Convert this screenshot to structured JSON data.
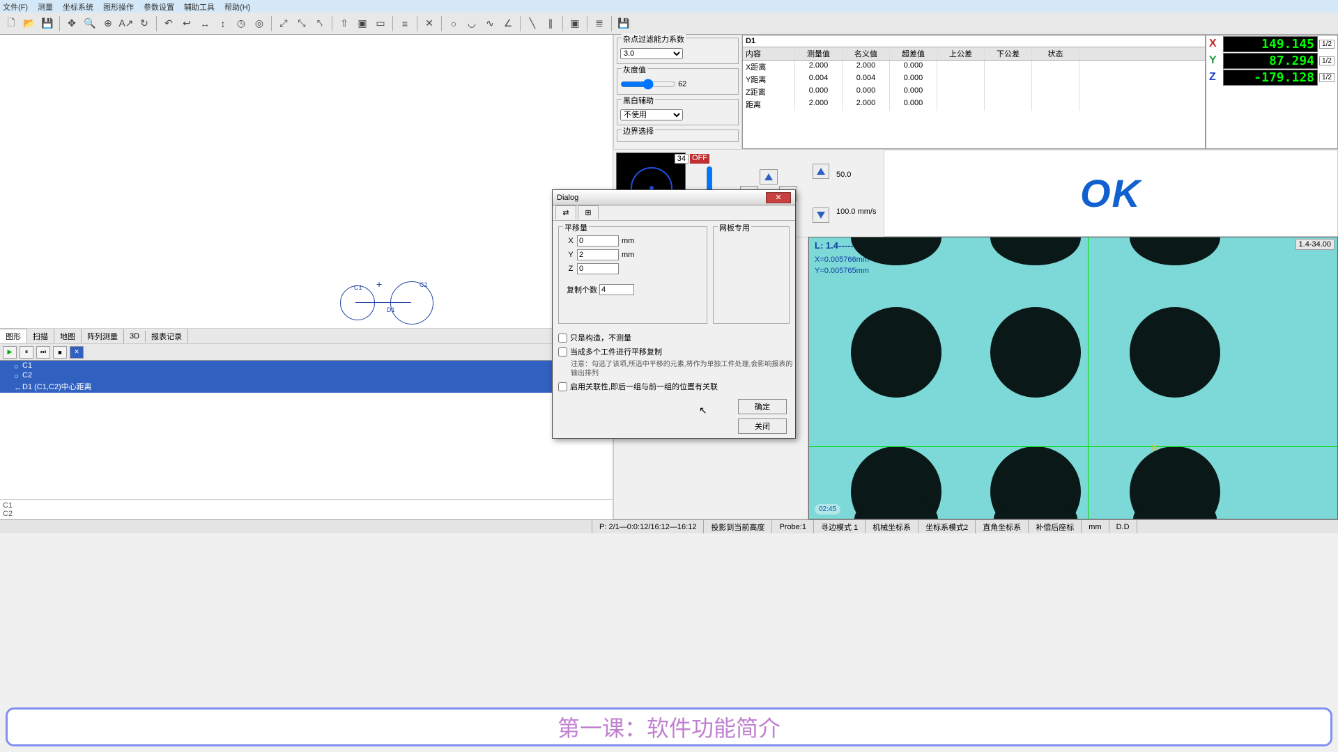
{
  "menu": [
    "文件(F)",
    "测量",
    "坐标系统",
    "图形操作",
    "参数设置",
    "辅助工具",
    "帮助(H)"
  ],
  "view_tabs": [
    "图形",
    "扫描",
    "地图",
    "阵列测量",
    "3D",
    "报表记录"
  ],
  "features": [
    {
      "name": "C1"
    },
    {
      "name": "C2"
    },
    {
      "name": "D1 (C1,C2)中心距离"
    }
  ],
  "result": {
    "title": "D1",
    "headers": [
      "内容",
      "测量值",
      "名义值",
      "超差值",
      "上公差",
      "下公差",
      "状态"
    ],
    "rows": [
      [
        "X距离",
        "2.000",
        "2.000",
        "0.000",
        "",
        "",
        ""
      ],
      [
        "Y距离",
        "0.004",
        "0.004",
        "0.000",
        "",
        "",
        ""
      ],
      [
        "Z距离",
        "0.000",
        "0.000",
        "0.000",
        "",
        "",
        ""
      ],
      [
        "距离",
        "2.000",
        "2.000",
        "0.000",
        "",
        "",
        ""
      ]
    ]
  },
  "coords": [
    {
      "axis": "X",
      "val": "149.145",
      "c": "#20e060",
      "half": "1/2"
    },
    {
      "axis": "Y",
      "val": "87.294",
      "c": "#20e060",
      "half": "1/2"
    },
    {
      "axis": "Z",
      "val": "-179.128",
      "c": "#20e060",
      "half": "1/2"
    }
  ],
  "ok_label": "OK",
  "camera": {
    "info": "L: 1.4------M:34.00",
    "x": "X=0.005766mm",
    "y": "Y=0.005765mm",
    "badge": "1.4-34.00",
    "time": "02:45"
  },
  "badge34": "34",
  "badgeOff": "OFF",
  "speed1": "50.0",
  "speed2": "100.0",
  "speed_unit": "mm/s",
  "filter": {
    "g1": "杂点过滤能力系数",
    "g1v": "3.0",
    "g2": "灰度值",
    "g2v": "62",
    "g3": "黑白辅助",
    "g3v": "不使用",
    "g4": "边界选择"
  },
  "dialog": {
    "title": "Dialog",
    "offset_label": "平移量",
    "net_label": "网板专用",
    "x": "X",
    "xv": "0",
    "y": "Y",
    "yv": "2",
    "z": "Z",
    "zv": "0",
    "unit": "mm",
    "copy_label": "复制个数",
    "copy_v": "4",
    "chk1": "只是构造，不测量",
    "chk2": "当成多个工件进行平移复制",
    "note": "注意：勾选了该项,所选中平移的元素,将作为单独工件处理,会影响报表的输出排列",
    "chk3": "启用关联性,即后一组与前一组的位置有关联",
    "ok": "确定",
    "cancel": "关闭"
  },
  "status": {
    "p": "P: 2/1—0:0:12/16:12—16:12",
    "proj": "投影到当前高度",
    "probe": "Probe:1",
    "mode": "寻边模式 1",
    "sys1": "机械坐标系",
    "sys2": "坐标系模式2",
    "sys3": "直角坐标系",
    "sys4": "补偿后座标",
    "unit": "mm",
    "dd": "D.D"
  },
  "banner": "第一课：软件功能简介",
  "bottom_list": [
    "C1",
    "C2"
  ],
  "canvas_labels": {
    "c1": "C1",
    "c2": "C2",
    "d1": "D1"
  }
}
